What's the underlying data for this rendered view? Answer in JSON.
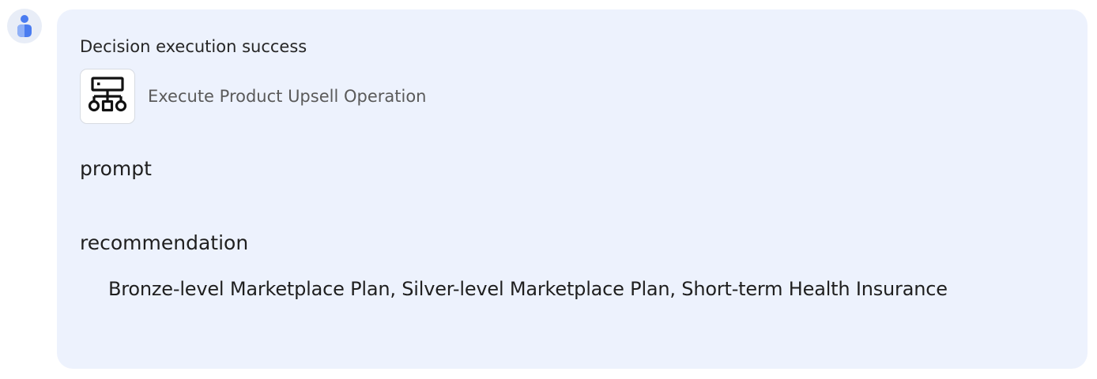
{
  "message": {
    "status_text": "Decision execution success",
    "tool": {
      "icon": "hierarchy-icon",
      "name": "Execute Product Upsell Operation"
    },
    "fields": {
      "prompt_label": "prompt",
      "recommendation_label": "recommendation",
      "recommendation_value": "Bronze-level Marketplace Plan, Silver-level Marketplace Plan, Short-term Health Insurance"
    }
  },
  "colors": {
    "bubble_background": "#edf2fd",
    "avatar_accent": "#4a7cf0",
    "text_primary": "#1f1f1f",
    "text_secondary": "#5a5a5a"
  }
}
